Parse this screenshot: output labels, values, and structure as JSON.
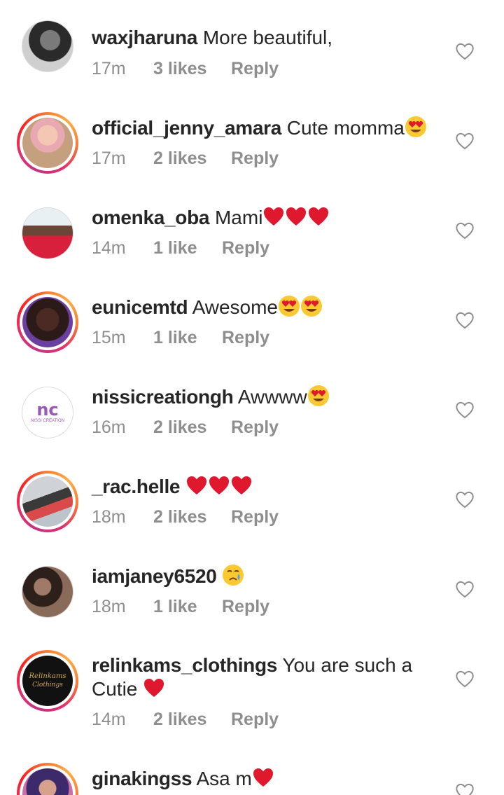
{
  "comments": [
    {
      "username": "waxjharuna",
      "text": " More beautiful,",
      "time": "17m",
      "likes": "3 likes",
      "reply": "Reply",
      "emojis": []
    },
    {
      "username": "official_jenny_amara",
      "text": " Cute momma",
      "time": "17m",
      "likes": "2 likes",
      "reply": "Reply",
      "emojis": [
        "heart-eyes"
      ]
    },
    {
      "username": "omenka_oba",
      "text": " Mami",
      "time": "14m",
      "likes": "1 like",
      "reply": "Reply",
      "emojis": [
        "red-heart",
        "red-heart",
        "red-heart"
      ]
    },
    {
      "username": "eunicemtd",
      "text": " Awesome",
      "time": "15m",
      "likes": "1 like",
      "reply": "Reply",
      "emojis": [
        "heart-eyes",
        "heart-eyes"
      ]
    },
    {
      "username": "nissicreationgh",
      "text": " Awwww",
      "time": "16m",
      "likes": "2 likes",
      "reply": "Reply",
      "emojis": [
        "heart-eyes"
      ]
    },
    {
      "username": "_rac.helle",
      "text": " ",
      "time": "18m",
      "likes": "2 likes",
      "reply": "Reply",
      "emojis": [
        "red-heart",
        "red-heart",
        "red-heart"
      ]
    },
    {
      "username": "iamjaney6520",
      "text": " ",
      "time": "18m",
      "likes": "1 like",
      "reply": "Reply",
      "emojis": [
        "crying-face"
      ]
    },
    {
      "username": "relinkams_clothings",
      "text": " You are such a Cutie ",
      "time": "14m",
      "likes": "2 likes",
      "reply": "Reply",
      "emojis": [
        "red-heart"
      ]
    },
    {
      "username": "ginakingss",
      "text": " Asa m",
      "time": "",
      "likes": "",
      "reply": "",
      "emojis": [
        "red-heart"
      ]
    }
  ],
  "avatar_logos": {
    "nissi": {
      "mark": "nc",
      "caption": "NISSI CREATION"
    },
    "relinkams": {
      "line1": "Relinkams",
      "line2": "Clothings"
    }
  },
  "colors": {
    "text": "#262626",
    "meta": "#8e8e8e",
    "heart_emoji": "#e0182d",
    "emoji_face": "#f9c932"
  },
  "icons": {
    "like": "heart-outline-icon"
  }
}
